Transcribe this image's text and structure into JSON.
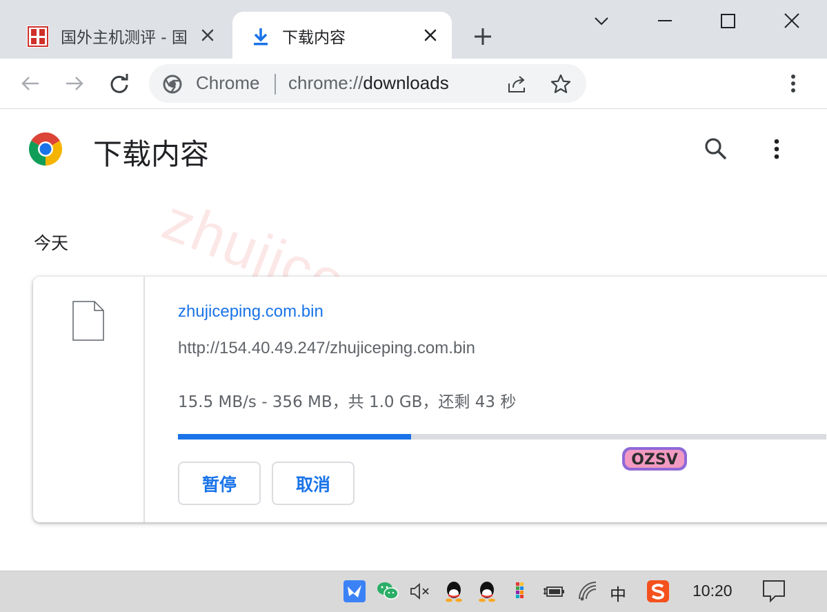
{
  "tabs": [
    {
      "title": "国外主机测评 - 国",
      "favicon": "site-seal-icon",
      "active": false
    },
    {
      "title": "下载内容",
      "favicon": "download-icon",
      "active": true
    }
  ],
  "window_controls": [
    "chevron-down-icon",
    "minimize-icon",
    "maximize-icon",
    "close-icon"
  ],
  "omnibox": {
    "chip": "Chrome",
    "url_scheme": "chrome://",
    "url_host": "downloads"
  },
  "page": {
    "title": "下载内容",
    "section_date": "今天"
  },
  "watermark": "zhujiceping.com",
  "download": {
    "file_name": "zhujiceping.com.bin",
    "url": "http://154.40.49.247/zhujiceping.com.bin",
    "status": "15.5 MB/s - 356 MB，共 1.0 GB，还剩 43 秒",
    "progress": 0.36,
    "pause_label": "暂停",
    "cancel_label": "取消"
  },
  "sticker_text": "OZSV",
  "taskbar": {
    "ime_label": "中",
    "clock": "10:20"
  },
  "colors": {
    "accent": "#1a73e8",
    "tabstrip": "#dee1e6"
  }
}
